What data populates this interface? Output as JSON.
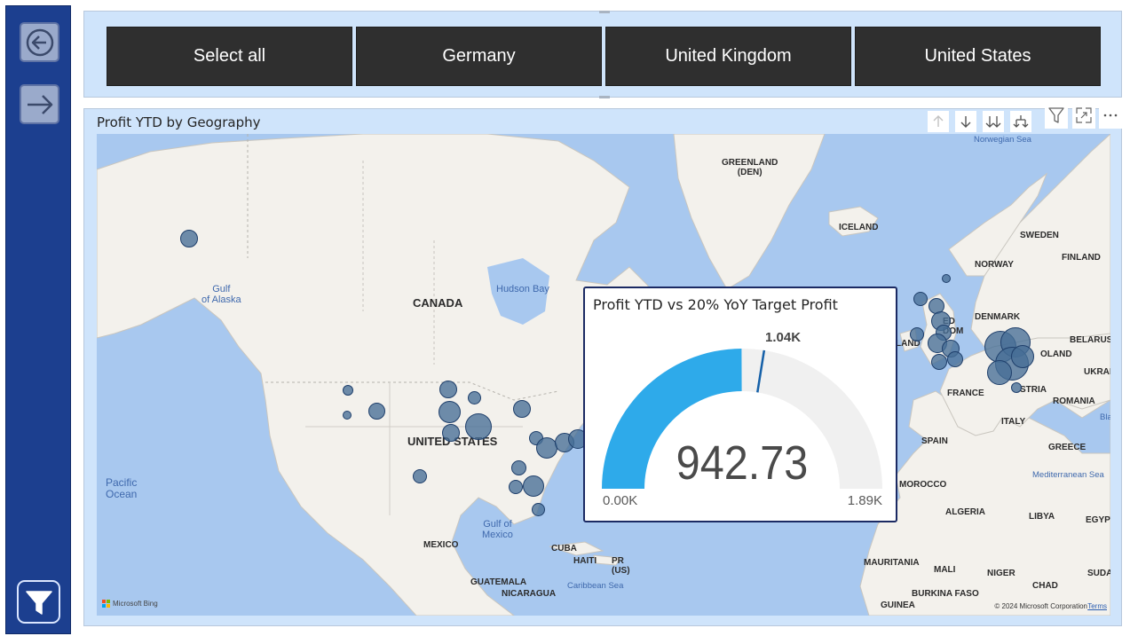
{
  "nav": {
    "back_icon": "arrow-back-circle-icon",
    "forward_icon": "arrow-right-icon",
    "filter_icon": "funnel-icon"
  },
  "slicer": {
    "options": [
      "Select all",
      "Germany",
      "United Kingdom",
      "United States"
    ]
  },
  "map": {
    "title": "Profit YTD by Geography",
    "labels": {
      "norwegian_sea": "Norwegian Sea",
      "greenland": "GREENLAND\n(DEN)",
      "iceland": "ICELAND",
      "sweden": "SWEDEN",
      "finland": "FINLAND",
      "norway": "NORWAY",
      "denmark": "DENMARK",
      "belarus": "BELARUS",
      "poland": "OLAND",
      "ukraine": "UKRAI",
      "united_kingdom": "ED\nDOM",
      "ireland": "LAND",
      "france": "FRANCE",
      "austria": "STRIA",
      "romania": "ROMANIA",
      "italy": "ITALY",
      "spain": "SPAIN",
      "greece": "GREECE",
      "morocco": "MOROCCO",
      "algeria": "ALGERIA",
      "libya": "LIBYA",
      "egypt": "EGYPT",
      "mauritania": "MAURITANIA",
      "mali": "MALI",
      "niger": "NIGER",
      "chad": "CHAD",
      "sudan": "SUDA",
      "burkina_faso": "BURKINA FASO",
      "guinea": "GUINEA",
      "mediterranean_sea": "Mediterranean Sea",
      "black_sea": "Bla",
      "canada": "CANADA",
      "hudson_bay": "Hudson Bay",
      "gulf_of_alaska": "Gulf\nof Alaska",
      "united_states": "UNITED STATES",
      "pacific_ocean": "Pacific\nOcean",
      "gulf_of_mexico": "Gulf of\nMexico",
      "mexico": "MEXICO",
      "cuba": "CUBA",
      "haiti": "HAITI",
      "pr": "PR\n(US)",
      "guatemala": "GUATEMALA",
      "nicaragua": "NICARAGUA",
      "caribbean_sea": "Caribbean Sea"
    },
    "attribution": "Microsoft Bing",
    "copyright": "© 2024 Microsoft Corporation",
    "terms": "Terms",
    "controls": {
      "drill_up_icon": "arrow-up-icon",
      "drill_down_icon": "arrow-down-icon",
      "expand_level_icon": "double-arrow-down-icon",
      "expand_hierarchy_icon": "fork-arrow-down-icon",
      "filter_icon": "funnel-outline-icon",
      "focus_icon": "focus-mode-icon",
      "more_icon": "more-options-icon"
    }
  },
  "tooltip_gauge": {
    "title": "Profit YTD vs 20% YoY Target Profit",
    "value_text": "942.73",
    "min_text": "0.00K",
    "max_text": "1.89K",
    "target_text": "1.04K",
    "value": 942.73,
    "min": 0,
    "max": 1890,
    "target": 1040,
    "fill_color": "#2eaaea",
    "track_color": "#f0f0f0",
    "target_color": "#1560a8"
  }
}
